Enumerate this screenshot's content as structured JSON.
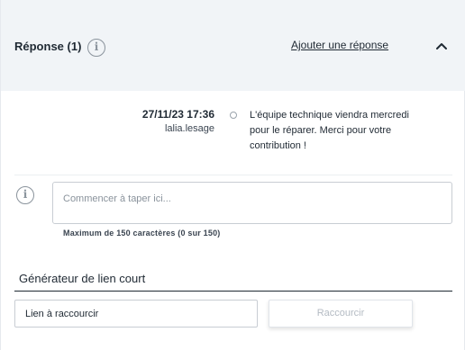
{
  "header": {
    "title": "Réponse (1)",
    "add_link": "Ajouter une réponse",
    "info_icon": "i"
  },
  "response": {
    "datetime": "27/11/23 17:36",
    "user": "lalia.lesage",
    "text": "L'équipe technique viendra mercredi pour le réparer. Merci pour votre contribution !"
  },
  "composer": {
    "info_icon": "i",
    "placeholder": "Commencer à taper ici...",
    "counter": "Maximum de 150 caractères (0 sur 150)"
  },
  "shortener": {
    "title": "Générateur de lien court",
    "input_placeholder": "Lien à raccourcir",
    "button_label": "Raccourcir"
  }
}
